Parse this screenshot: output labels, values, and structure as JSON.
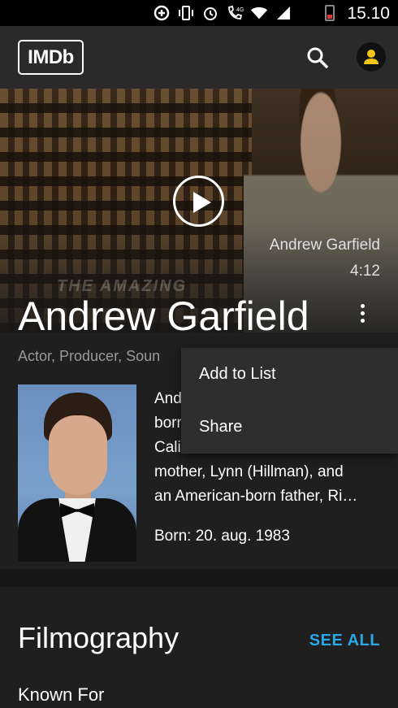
{
  "status_bar": {
    "time": "15.10",
    "network": "4G",
    "icons": [
      "data-saver-icon",
      "vibrate-icon",
      "alarm-icon",
      "call-icon",
      "wifi-icon",
      "signal-icon",
      "battery-icon"
    ]
  },
  "app_bar": {
    "logo_text": "IMDb",
    "icons": [
      "search-icon",
      "account-icon"
    ],
    "accent_color": "#f5c518"
  },
  "hero": {
    "watermark": "THE AMAZING",
    "video_caption": "Andrew Garfield",
    "video_duration": "4:12"
  },
  "person": {
    "name": "Andrew Garfield",
    "roles": "Actor, Producer, Soun",
    "bio_lines": [
      "And",
      "born",
      "Cali",
      "mother, Lynn (Hillman), and",
      "an American-born father, Ri…"
    ],
    "born": "Born: 20. aug. 1983"
  },
  "menu": {
    "items": [
      "Add to List",
      "Share"
    ]
  },
  "filmography": {
    "title": "Filmography",
    "see_all": "SEE ALL",
    "known_for": "Known For",
    "link_color": "#2aa7e8"
  }
}
